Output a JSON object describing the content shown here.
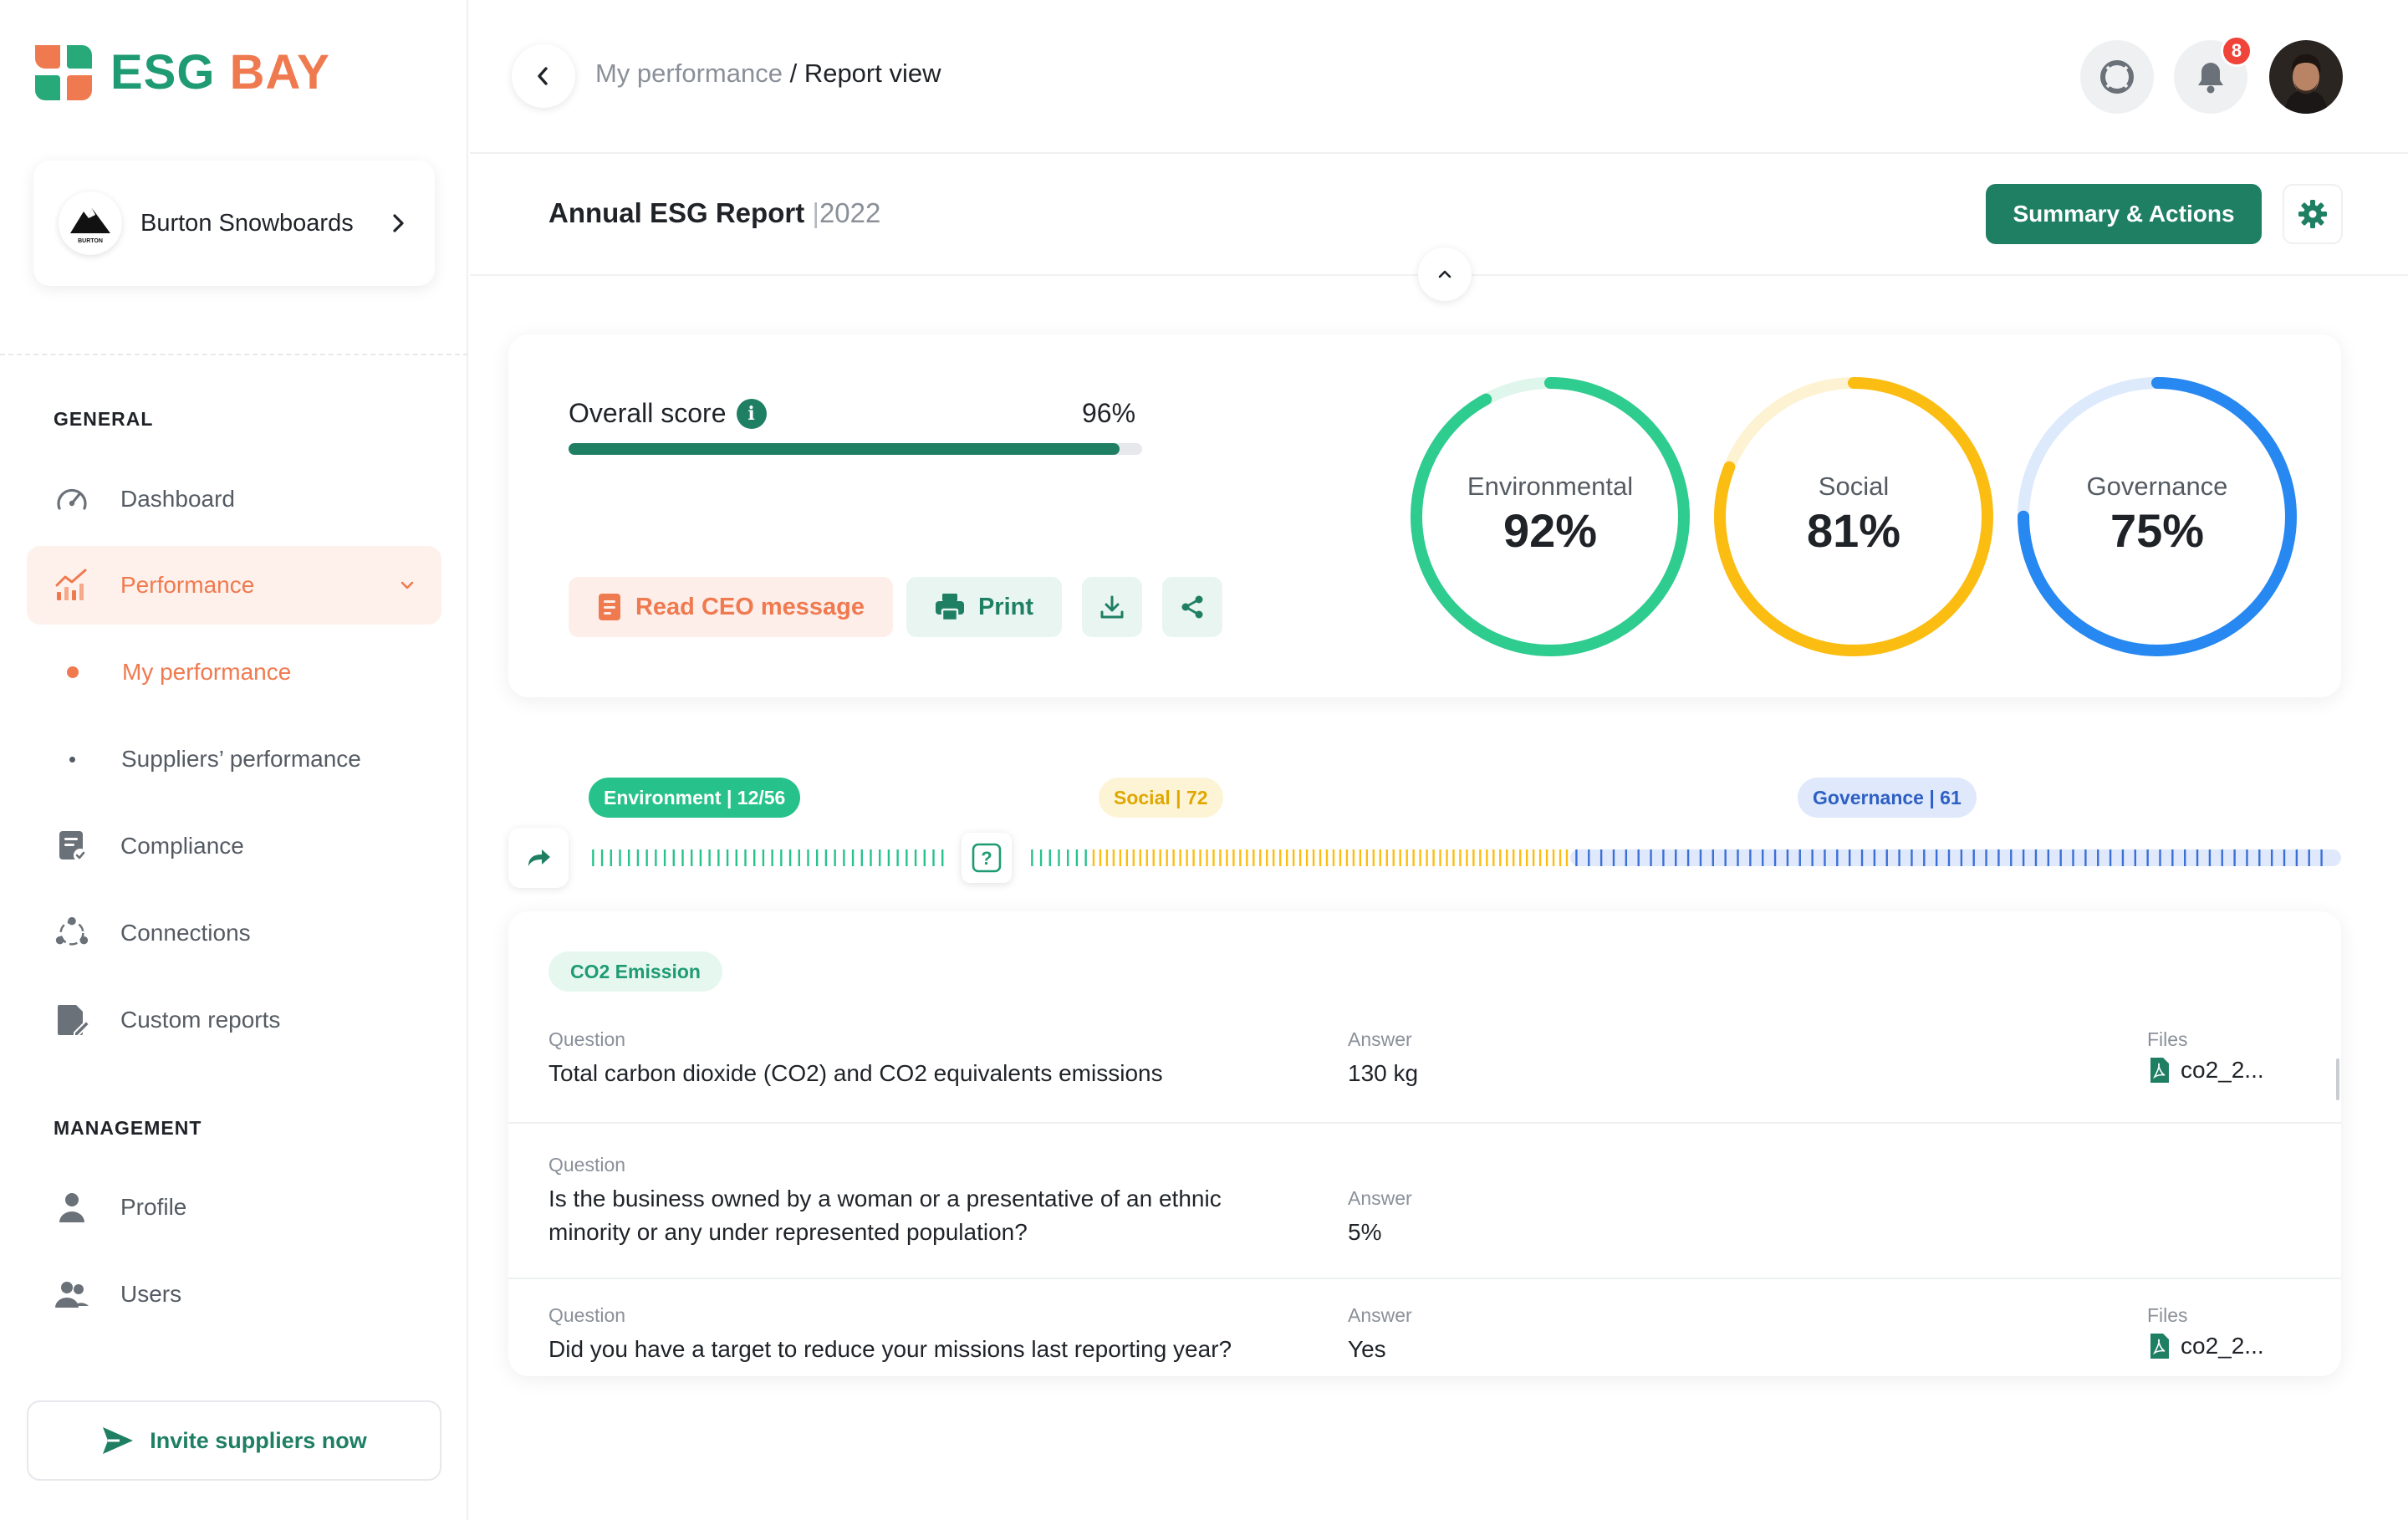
{
  "brand": {
    "part1": "ESG",
    "part2": "BAY"
  },
  "company": {
    "name": "Burton Snowboards",
    "logo_text": "BURTON"
  },
  "sidebar": {
    "general_title": "GENERAL",
    "management_title": "MANAGEMENT",
    "items": {
      "dashboard": "Dashboard",
      "performance": "Performance",
      "my_performance": "My performance",
      "suppliers_performance": "Suppliers’ performance",
      "compliance": "Compliance",
      "connections": "Connections",
      "custom_reports": "Custom reports",
      "profile": "Profile",
      "users": "Users"
    },
    "invite_label": "Invite suppliers now"
  },
  "header": {
    "crumb_parent": "My performance",
    "crumb_sep": " / ",
    "crumb_current": "Report view",
    "notification_count": "8"
  },
  "report": {
    "title": "Annual ESG Report",
    "separator": "|",
    "year": "2022",
    "summary_button": "Summary & Actions"
  },
  "overall": {
    "label": "Overall score",
    "info_glyph": "i",
    "value_text": "96%",
    "progress": 0.96
  },
  "actions": {
    "ceo": "Read CEO message",
    "print": "Print"
  },
  "scores": [
    {
      "label": "Environmental",
      "value_text": "92%",
      "value": 0.92,
      "color": "#2ecc8f",
      "track": "#dff6ec"
    },
    {
      "label": "Social",
      "value_text": "81%",
      "value": 0.81,
      "color": "#fbbd12",
      "track": "#fdf2d2"
    },
    {
      "label": "Governance",
      "value_text": "75%",
      "value": 0.75,
      "color": "#2688f0",
      "track": "#dceafc"
    }
  ],
  "timeline": {
    "environment_tag": "Environment | 12/56",
    "social_tag": "Social | 72",
    "governance_tag": "Governance | 61",
    "counts": {
      "environment": 56,
      "social": 72,
      "governance": 61
    },
    "colors": {
      "environment": "#27c28b",
      "social": "#fbbd12",
      "governance": "#3b6fd8",
      "governance_bg": "#dfe9fb"
    },
    "current_marker": "?"
  },
  "qa": {
    "section_tag": "CO2 Emission",
    "question_label": "Question",
    "answer_label": "Answer",
    "files_label": "Files",
    "rows": [
      {
        "question": "Total carbon dioxide (CO2) and CO2 equivalents emissions",
        "answer": "130 kg",
        "file": "co2_2..."
      },
      {
        "question_line1": "Is the business owned by a woman or a presentative of an ethnic",
        "question_line2": "minority or any under represented population?",
        "answer": "5%"
      },
      {
        "question": "Did you have a target to reduce your missions last reporting year?",
        "answer": "Yes",
        "file": "co2_2..."
      }
    ]
  }
}
